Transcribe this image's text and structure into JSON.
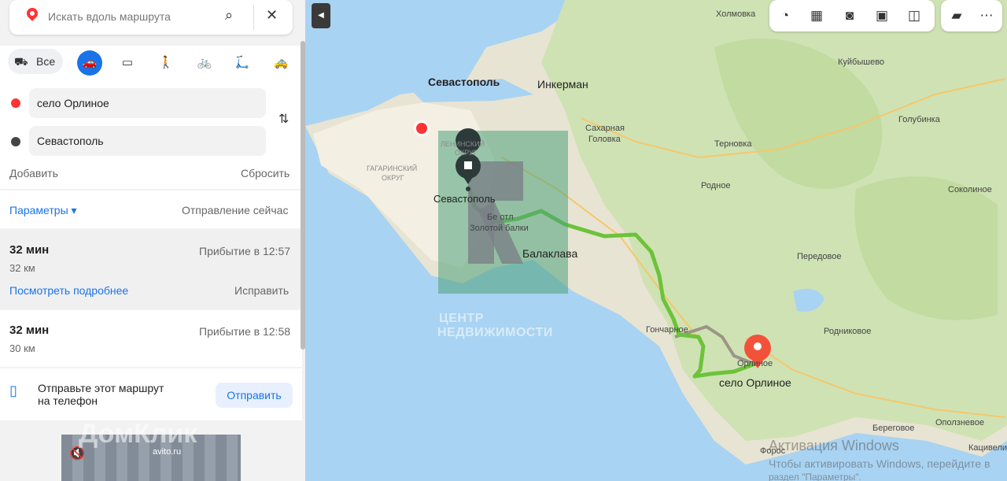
{
  "search": {
    "placeholder": "Искать вдоль маршрута"
  },
  "modes": {
    "all_label": "Все",
    "items": [
      "car",
      "bus",
      "walk",
      "bike",
      "scooter",
      "taxi"
    ]
  },
  "route": {
    "from": "село Орлиное",
    "to": "Севастополь",
    "add_label": "Добавить",
    "reset_label": "Сбросить"
  },
  "params": {
    "label": "Параметры ▾",
    "departure": "Отправление сейчас"
  },
  "options": [
    {
      "time": "32 мин",
      "distance": "32 км",
      "arrival": "Прибытие в 12:57",
      "details": "Посмотреть подробнее",
      "fix": "Исправить"
    },
    {
      "time": "32 мин",
      "distance": "30 км",
      "arrival": "Прибытие в 12:58"
    }
  ],
  "send": {
    "text_line1": "Отправьте этот маршрут",
    "text_line2": "на телефон",
    "button": "Отправить"
  },
  "ad": {
    "brand": "ДомКлик",
    "source": "avito.ru"
  },
  "map": {
    "labels": {
      "sevastopol_big": "Севастополь",
      "inkerman": "Инкерман",
      "kholmovka": "Холмовка",
      "kuibyshevo": "Куйбышево",
      "golubinka": "Голубинка",
      "sakharnaya1": "Сахарная",
      "sakharnaya2": "Головка",
      "ternovka": "Терновка",
      "rodnoe": "Родное",
      "sokolinoe": "Соколиное",
      "leninsky1": "ЛЕНИНСКИЙ",
      "leninsky2": "ОКРУГ",
      "gagarinsky1": "ГАГАРИНСКИЙ",
      "gagarinsky2": "ОКРУГ",
      "sevastopol_end": "Севастополь",
      "otl1": "Бе отл",
      "otl2": "Золотой балки",
      "balaklava": "Балаклава",
      "peredovoe": "Передовое",
      "goncharnoe": "Гончарное",
      "rodnikovoe": "Родниковое",
      "orlinoe": "Орлиное",
      "orlinoe_village": "село Орлиное",
      "beregovoe": "Береговое",
      "opolznevoe": "Оползневое",
      "foros": "Форос",
      "katsiveli": "Кацивели"
    },
    "watermark": {
      "line1": "ЦЕНТР",
      "line2": "НЕДВИЖИМОСТИ"
    },
    "os_notice": {
      "line1": "Активация Windows",
      "line2": "Чтобы активировать Windows, перейдите в",
      "line3": "раздел \"Параметры\"."
    }
  },
  "colors": {
    "accent": "#1a73e8",
    "route": "#6cc33a",
    "start": "#f33",
    "sea": "#a9d3f2"
  }
}
